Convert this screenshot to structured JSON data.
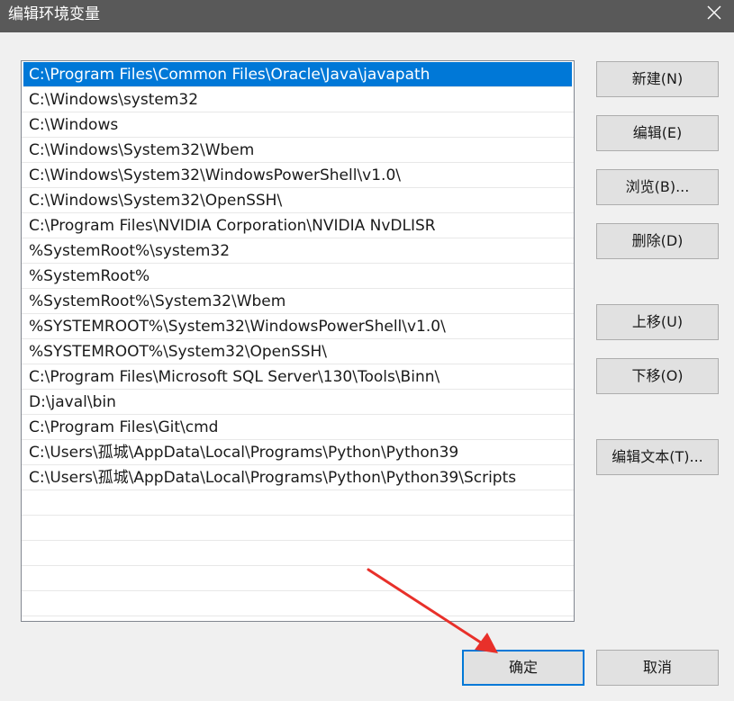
{
  "window": {
    "title": "编辑环境变量"
  },
  "paths": [
    "C:\\Program Files\\Common Files\\Oracle\\Java\\javapath",
    "C:\\Windows\\system32",
    "C:\\Windows",
    "C:\\Windows\\System32\\Wbem",
    "C:\\Windows\\System32\\WindowsPowerShell\\v1.0\\",
    "C:\\Windows\\System32\\OpenSSH\\",
    "C:\\Program Files\\NVIDIA Corporation\\NVIDIA NvDLISR",
    "%SystemRoot%\\system32",
    "%SystemRoot%",
    "%SystemRoot%\\System32\\Wbem",
    "%SYSTEMROOT%\\System32\\WindowsPowerShell\\v1.0\\",
    "%SYSTEMROOT%\\System32\\OpenSSH\\",
    "C:\\Program Files\\Microsoft SQL Server\\130\\Tools\\Binn\\",
    "D:\\javal\\bin",
    "C:\\Program Files\\Git\\cmd",
    "C:\\Users\\孤城\\AppData\\Local\\Programs\\Python\\Python39",
    "C:\\Users\\孤城\\AppData\\Local\\Programs\\Python\\Python39\\Scripts"
  ],
  "selected_index": 0,
  "buttons": {
    "new": "新建(N)",
    "edit": "编辑(E)",
    "browse": "浏览(B)...",
    "delete": "删除(D)",
    "move_up": "上移(U)",
    "move_down": "下移(O)",
    "edit_text": "编辑文本(T)...",
    "ok": "确定",
    "cancel": "取消"
  },
  "colors": {
    "titlebar": "#595959",
    "selection": "#0078d7",
    "annotation_arrow": "#e8302a"
  },
  "icons": {
    "close": "close-icon",
    "annotation": "red-arrow-annotation"
  }
}
